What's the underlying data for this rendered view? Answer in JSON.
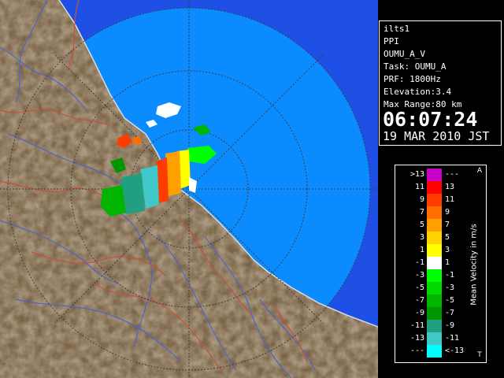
{
  "header": {
    "site": "ilts1",
    "scan_type": "PPI",
    "product": "OUMU_A_V",
    "task": "Task: OUMU_A",
    "prf": "PRF: 1800Hz",
    "elevation": "Elevation:3.4",
    "max_range": "Max Range:80 km",
    "time": "06:07:24",
    "date": "19 MAR 2010 JST"
  },
  "legend": {
    "title": "Mean Velocity in m/s",
    "top_marker": "A",
    "bottom_marker": "T",
    "rows": [
      {
        "left": ">13",
        "right": "---",
        "color": "#c800c8"
      },
      {
        "left": "11",
        "right": "13",
        "color": "#ff0000"
      },
      {
        "left": "9",
        "right": "11",
        "color": "#ff3c00"
      },
      {
        "left": "7",
        "right": "9",
        "color": "#ff6e00"
      },
      {
        "left": "5",
        "right": "7",
        "color": "#ffa000"
      },
      {
        "left": "3",
        "right": "5",
        "color": "#ffd200"
      },
      {
        "left": "1",
        "right": "3",
        "color": "#ffff00"
      },
      {
        "left": "-1",
        "right": "1",
        "color": "#ffffff"
      },
      {
        "left": "-3",
        "right": "-1",
        "color": "#00ff00"
      },
      {
        "left": "-5",
        "right": "-3",
        "color": "#00d800"
      },
      {
        "left": "-7",
        "right": "-5",
        "color": "#00b400"
      },
      {
        "left": "-9",
        "right": "-7",
        "color": "#009600"
      },
      {
        "left": "-11",
        "right": "-9",
        "color": "#20a080"
      },
      {
        "left": "-13",
        "right": "-11",
        "color": "#40c8c8"
      },
      {
        "left": "---",
        "right": "<-13",
        "color": "#00ffff"
      }
    ]
  },
  "colors": {
    "sea_outer": "#1e50e6",
    "sea_inner": "#0a8cff",
    "land": "#7a6448",
    "rivers": "#5064c8",
    "borders": "#c8503c",
    "range_rings": "#3c3c46"
  }
}
